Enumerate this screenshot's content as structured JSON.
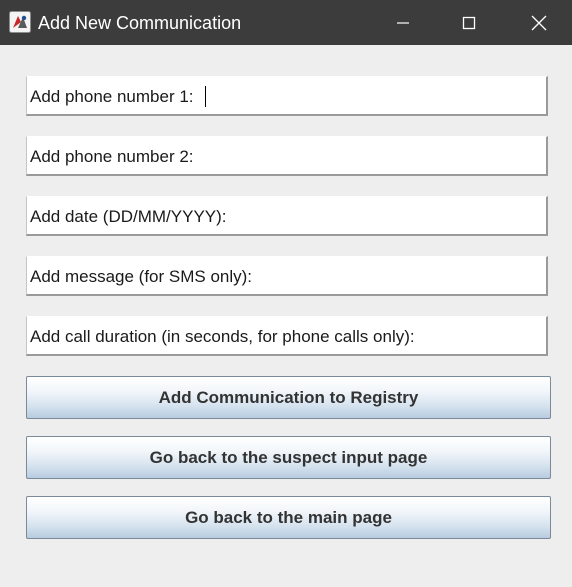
{
  "window": {
    "title": "Add New Communication",
    "icons": {
      "app": "java-app-icon",
      "minimize": "minimize-icon",
      "maximize": "maximize-icon",
      "close": "close-icon"
    }
  },
  "form": {
    "fields": [
      {
        "label": "Add phone number 1:",
        "value": "",
        "focused": true
      },
      {
        "label": "Add phone number 2:",
        "value": ""
      },
      {
        "label": "Add date (DD/MM/YYYY):",
        "value": ""
      },
      {
        "label": "Add message (for SMS only):",
        "value": ""
      },
      {
        "label": "Add call duration (in seconds, for phone calls only):",
        "value": ""
      }
    ]
  },
  "buttons": {
    "add": "Add Communication to Registry",
    "back_suspect": "Go back to the suspect input page",
    "back_main": "Go back to the main page"
  },
  "colors": {
    "titlebar": "#3c3c3c",
    "window_bg": "#eeeeee",
    "field_bg": "#ffffff",
    "button_text": "#333333"
  }
}
